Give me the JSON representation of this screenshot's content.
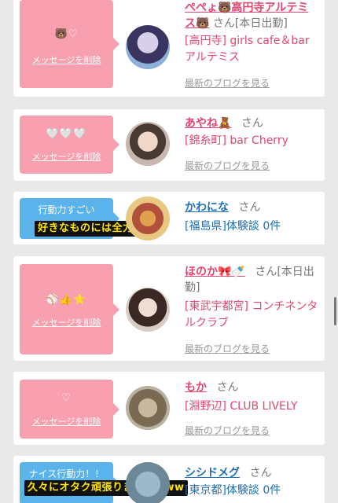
{
  "delete_label": "メッセージを削除",
  "blog_label": "最新のブログを見る",
  "cards": [
    {
      "emoji": "🐻♡",
      "name": "ぺぺょ🐻高円寺アルテミス🐻",
      "san": "さん",
      "status": "[本日出勤]",
      "shop": "[高円寺] girls cafe＆bar アルテミス"
    },
    {
      "emoji": "🤍🤍🤍",
      "name": "あやね🧸",
      "san": "さん",
      "status": "",
      "shop": "[錦糸町] bar Cherry"
    },
    {
      "badge": "行動力すごい",
      "ticker": "好きなものには全力",
      "name": "かわにな",
      "san": "さん",
      "shop": "[福島県]体験談 0件"
    },
    {
      "emoji": "⚾👍⭐",
      "name": "ほのか🎀🍼",
      "san": "さん",
      "status": "[本日出勤]",
      "shop": "[東武宇都宮] コンチネンタルクラブ"
    },
    {
      "emoji": "♡",
      "name": "もか",
      "san": "さん",
      "status": "",
      "shop": "[淵野辺] CLUB LIVELY"
    },
    {
      "badge": "ナイス行動力！！",
      "ticker": "久々にオタク頑張りましたwww",
      "name": "シシドメグ",
      "san": "さん",
      "shop": "[東京都]体験談 0件"
    }
  ]
}
